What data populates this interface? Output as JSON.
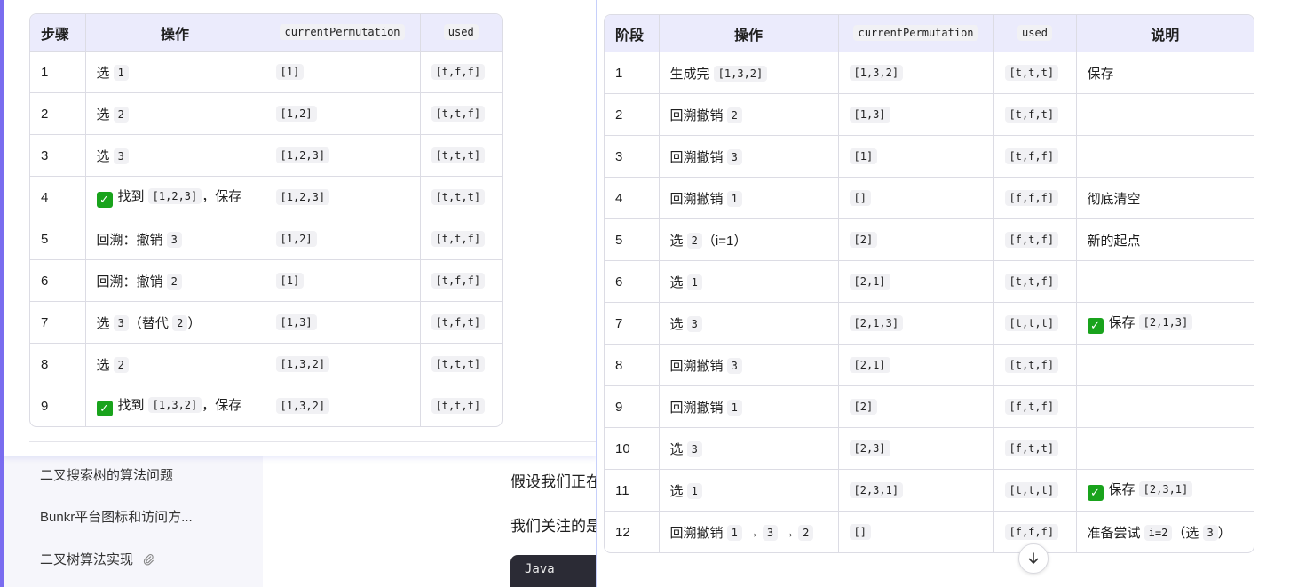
{
  "sidebar": {
    "history": [
      {
        "label": "二叉搜索树的算法问题",
        "attachment": false
      },
      {
        "label": "Bunkr平台图标和访问方...",
        "attachment": false
      },
      {
        "label": "二叉树算法实现",
        "attachment": true
      }
    ]
  },
  "main": {
    "line1": "假设我们正在",
    "line2": "我们关注的是",
    "code_lang": "Java"
  },
  "left_table": {
    "headers": [
      "步骤",
      "操作",
      "currentPermutation",
      "used"
    ],
    "rows": [
      {
        "step": "1",
        "op": [
          {
            "t": "选 "
          },
          {
            "c": "1"
          }
        ],
        "perm": "[1]",
        "used": "[t,f,f]"
      },
      {
        "step": "2",
        "op": [
          {
            "t": "选 "
          },
          {
            "c": "2"
          }
        ],
        "perm": "[1,2]",
        "used": "[t,t,f]"
      },
      {
        "step": "3",
        "op": [
          {
            "t": "选 "
          },
          {
            "c": "3"
          }
        ],
        "perm": "[1,2,3]",
        "used": "[t,t,t]"
      },
      {
        "step": "4",
        "op": [
          {
            "ok": "✓"
          },
          {
            "t": "找到 "
          },
          {
            "c": "[1,2,3]"
          },
          {
            "t": "，保存"
          }
        ],
        "perm": "[1,2,3]",
        "used": "[t,t,t]"
      },
      {
        "step": "5",
        "op": [
          {
            "t": "回溯：撤销 "
          },
          {
            "c": "3"
          }
        ],
        "perm": "[1,2]",
        "used": "[t,t,f]"
      },
      {
        "step": "6",
        "op": [
          {
            "t": "回溯：撤销 "
          },
          {
            "c": "2"
          }
        ],
        "perm": "[1]",
        "used": "[t,f,f]"
      },
      {
        "step": "7",
        "op": [
          {
            "t": "选 "
          },
          {
            "c": "3"
          },
          {
            "t": "（替代 "
          },
          {
            "c": "2"
          },
          {
            "t": "）"
          }
        ],
        "perm": "[1,3]",
        "used": "[t,f,t]"
      },
      {
        "step": "8",
        "op": [
          {
            "t": "选 "
          },
          {
            "c": "2"
          }
        ],
        "perm": "[1,3,2]",
        "used": "[t,t,t]"
      },
      {
        "step": "9",
        "op": [
          {
            "ok": "✓"
          },
          {
            "t": "找到 "
          },
          {
            "c": "[1,3,2]"
          },
          {
            "t": "，保存"
          }
        ],
        "perm": "[1,3,2]",
        "used": "[t,t,t]"
      }
    ]
  },
  "right_table": {
    "headers": [
      "阶段",
      "操作",
      "currentPermutation",
      "used",
      "说明"
    ],
    "rows": [
      {
        "step": "1",
        "op": [
          {
            "t": "生成完 "
          },
          {
            "c": "[1,3,2]"
          }
        ],
        "perm": "[1,3,2]",
        "used": "[t,t,t]",
        "note": [
          {
            "t": "保存"
          }
        ]
      },
      {
        "step": "2",
        "op": [
          {
            "t": "回溯撤销 "
          },
          {
            "c": "2"
          }
        ],
        "perm": "[1,3]",
        "used": "[t,f,t]",
        "note": []
      },
      {
        "step": "3",
        "op": [
          {
            "t": "回溯撤销 "
          },
          {
            "c": "3"
          }
        ],
        "perm": "[1]",
        "used": "[t,f,f]",
        "note": []
      },
      {
        "step": "4",
        "op": [
          {
            "t": "回溯撤销 "
          },
          {
            "c": "1"
          }
        ],
        "perm": "[]",
        "used": "[f,f,f]",
        "note": [
          {
            "t": "彻底清空"
          }
        ]
      },
      {
        "step": "5",
        "op": [
          {
            "t": "选 "
          },
          {
            "c": "2"
          },
          {
            "t": "（i=1）"
          }
        ],
        "perm": "[2]",
        "used": "[f,t,f]",
        "note": [
          {
            "t": "新的起点"
          }
        ]
      },
      {
        "step": "6",
        "op": [
          {
            "t": "选 "
          },
          {
            "c": "1"
          }
        ],
        "perm": "[2,1]",
        "used": "[t,t,f]",
        "note": []
      },
      {
        "step": "7",
        "op": [
          {
            "t": "选 "
          },
          {
            "c": "3"
          }
        ],
        "perm": "[2,1,3]",
        "used": "[t,t,t]",
        "note": [
          {
            "ok": "✓"
          },
          {
            "t": "保存 "
          },
          {
            "c": "[2,1,3]"
          }
        ]
      },
      {
        "step": "8",
        "op": [
          {
            "t": "回溯撤销 "
          },
          {
            "c": "3"
          }
        ],
        "perm": "[2,1]",
        "used": "[t,t,f]",
        "note": []
      },
      {
        "step": "9",
        "op": [
          {
            "t": "回溯撤销 "
          },
          {
            "c": "1"
          }
        ],
        "perm": "[2]",
        "used": "[f,t,f]",
        "note": []
      },
      {
        "step": "10",
        "op": [
          {
            "t": "选 "
          },
          {
            "c": "3"
          }
        ],
        "perm": "[2,3]",
        "used": "[f,t,t]",
        "note": []
      },
      {
        "step": "11",
        "op": [
          {
            "t": "选 "
          },
          {
            "c": "1"
          }
        ],
        "perm": "[2,3,1]",
        "used": "[t,t,t]",
        "note": [
          {
            "ok": "✓"
          },
          {
            "t": "保存 "
          },
          {
            "c": "[2,3,1]"
          }
        ]
      },
      {
        "step": "12",
        "op": [
          {
            "t": "回溯撤销 "
          },
          {
            "c": "1"
          },
          {
            "a": "→"
          },
          {
            "c": "3"
          },
          {
            "a": "→"
          },
          {
            "c": "2"
          }
        ],
        "perm": "[]",
        "used": "[f,f,f]",
        "note": [
          {
            "t": "准备尝试 "
          },
          {
            "c": "i=2"
          },
          {
            "t": "（选 "
          },
          {
            "c": "3"
          },
          {
            "t": "）"
          }
        ]
      }
    ]
  },
  "icons": {
    "check": "check-mark-icon",
    "attachment": "paperclip-icon",
    "scroll": "arrow-down-icon"
  },
  "colors": {
    "accent": "#7a6cf0",
    "header_bg": "#ebebfc",
    "check_green": "#19a31c",
    "panel_border": "#c6cffa"
  }
}
